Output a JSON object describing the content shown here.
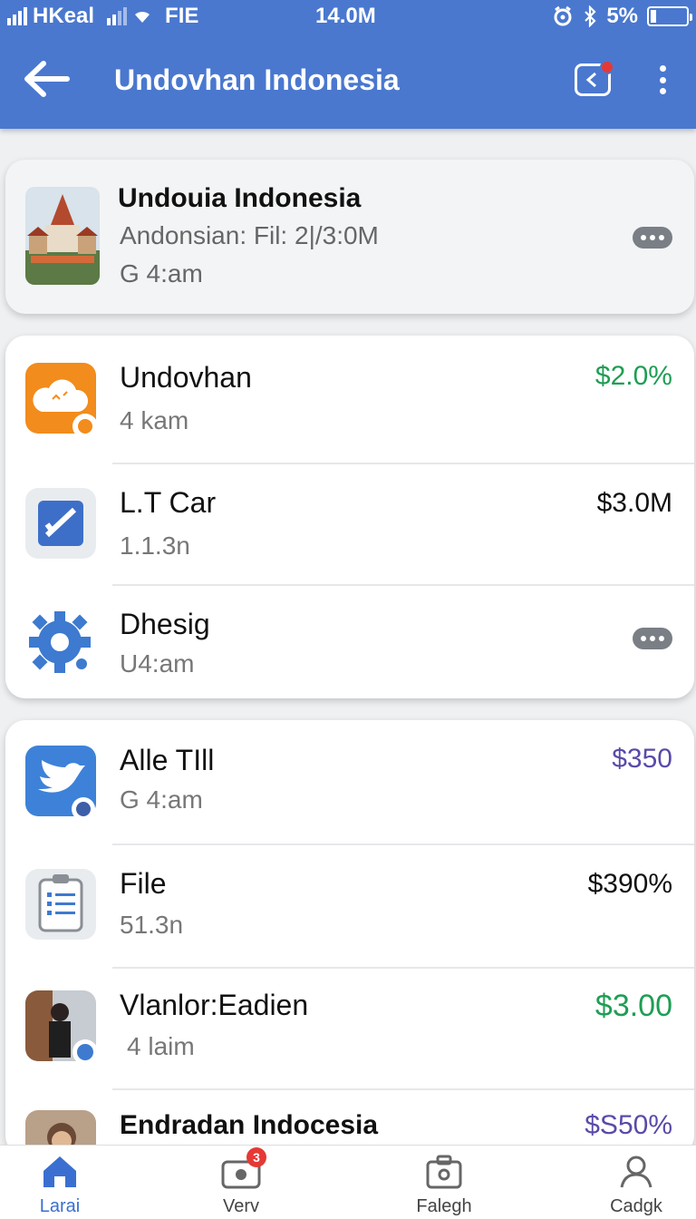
{
  "status_bar": {
    "carrier": "HKeal",
    "network": "FIE",
    "time": "14.0M",
    "battery": "5%"
  },
  "header": {
    "title": "Undovhan Indonesia"
  },
  "featured": {
    "title": "Undouia Indonesia",
    "line2": "Andonsian: Fil: 2|/3:0M",
    "line3": "G 4:am"
  },
  "group1": [
    {
      "name": "Undovhan",
      "sub": "4 kam",
      "amount": "$2.0%",
      "amount_color": "#1e9e54",
      "icon": "cloud-icon"
    },
    {
      "name": "L.T Car",
      "sub": "1.1.3n",
      "amount": "$3.0M",
      "amount_color": "#111111",
      "icon": "checkbox-icon"
    },
    {
      "name": "Dhesig",
      "sub": "U4:am",
      "amount": "",
      "amount_color": "#111111",
      "icon": "gear-icon"
    }
  ],
  "group2": [
    {
      "name": "Alle TIll",
      "sub": "G 4:am",
      "amount": "$350",
      "amount_color": "#5a4aa8",
      "icon": "bird-icon"
    },
    {
      "name": "File",
      "sub": "51.3n",
      "amount": "$390%",
      "amount_color": "#111111",
      "icon": "clipboard-icon"
    },
    {
      "name": "Vlanlor:Eadien",
      "sub": "4 laim",
      "amount": "$3.00",
      "amount_color": "#1e9e54",
      "icon": "person-photo"
    },
    {
      "name": "Endradan Indocesia",
      "sub": "",
      "amount": "$S50%",
      "amount_color": "#5a4aa8",
      "icon": "person-photo"
    }
  ],
  "bottom_nav": [
    {
      "label": "Larai",
      "icon": "home-icon",
      "active": true
    },
    {
      "label": "Verv",
      "icon": "camera-icon",
      "badge": "3"
    },
    {
      "label": "Falegh",
      "icon": "briefcase-icon"
    },
    {
      "label": "Cadgk",
      "icon": "person-icon"
    }
  ],
  "colors": {
    "primary": "#4a78cf",
    "green": "#1e9e54",
    "purple": "#5a4aa8"
  }
}
